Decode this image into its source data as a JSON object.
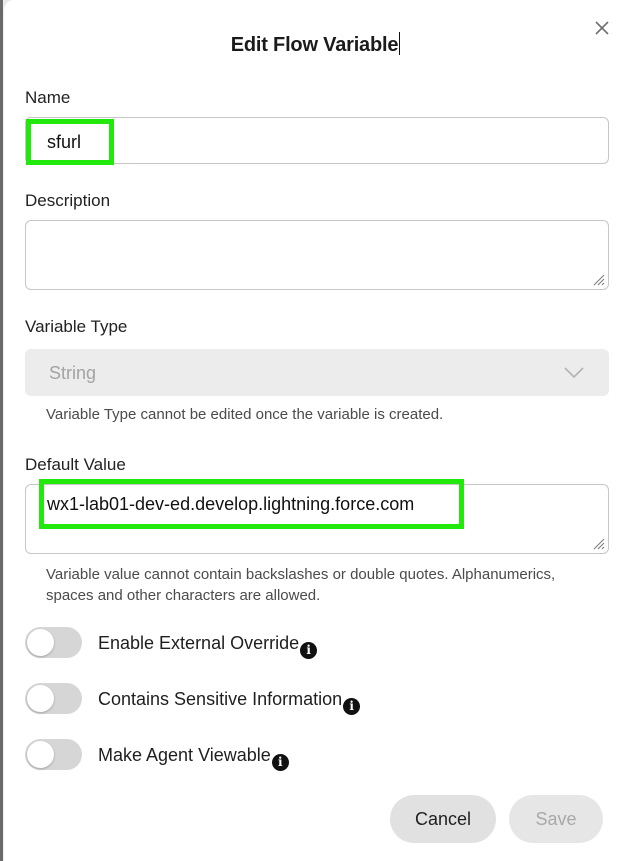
{
  "dialog": {
    "title": "Edit Flow Variable",
    "close_icon": "close-icon"
  },
  "name_field": {
    "label": "Name",
    "value": "sfurl"
  },
  "description_field": {
    "label": "Description",
    "value": ""
  },
  "variable_type": {
    "label": "Variable Type",
    "value": "String",
    "disabled": true,
    "helper": "Variable Type cannot be edited once the variable is created."
  },
  "default_value": {
    "label": "Default Value",
    "value": "wx1-lab01-dev-ed.develop.lightning.force.com",
    "helper": "Variable value cannot contain backslashes or double quotes. Alphanumerics, spaces and other characters are allowed."
  },
  "toggles": [
    {
      "label": "Enable External Override",
      "on": false,
      "info_icon": "info-icon"
    },
    {
      "label": "Contains Sensitive Information",
      "on": false,
      "info_icon": "info-icon"
    },
    {
      "label": "Make Agent Viewable",
      "on": false,
      "info_icon": "info-icon"
    }
  ],
  "footer": {
    "cancel_label": "Cancel",
    "save_label": "Save",
    "save_enabled": false
  },
  "colors": {
    "highlight": "#22e80c",
    "toggle_off": "#d6d6d6",
    "disabled_field": "#ececec"
  }
}
